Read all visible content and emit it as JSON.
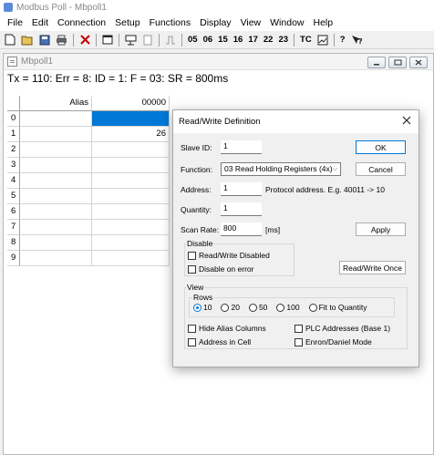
{
  "app": {
    "title": "Modbus Poll - Mbpoll1"
  },
  "menu": [
    "File",
    "Edit",
    "Connection",
    "Setup",
    "Functions",
    "Display",
    "View",
    "Window",
    "Help"
  ],
  "toolbar": {
    "function_codes": [
      "05",
      "06",
      "15",
      "16",
      "17",
      "22",
      "23"
    ],
    "tc_label": "TC",
    "help_label": "?"
  },
  "child": {
    "title": "Mbpoll1",
    "status": "Tx = 110: Err = 8: ID = 1: F = 03: SR = 800ms",
    "grid": {
      "alias_header": "Alias",
      "value_header": "00000",
      "rows": [
        {
          "index": "0",
          "alias": "",
          "value": ""
        },
        {
          "index": "1",
          "alias": "",
          "value": "26"
        },
        {
          "index": "2",
          "alias": "",
          "value": ""
        },
        {
          "index": "3",
          "alias": "",
          "value": ""
        },
        {
          "index": "4",
          "alias": "",
          "value": ""
        },
        {
          "index": "5",
          "alias": "",
          "value": ""
        },
        {
          "index": "6",
          "alias": "",
          "value": ""
        },
        {
          "index": "7",
          "alias": "",
          "value": ""
        },
        {
          "index": "8",
          "alias": "",
          "value": ""
        },
        {
          "index": "9",
          "alias": "",
          "value": ""
        }
      ]
    }
  },
  "dialog": {
    "title": "Read/Write Definition",
    "slave_id_label": "Slave ID:",
    "slave_id_value": "1",
    "function_label": "Function:",
    "function_value": "03 Read Holding Registers (4x)",
    "address_label": "Address:",
    "address_value": "1",
    "address_hint": "Protocol address. E.g. 40011 -> 10",
    "quantity_label": "Quantity:",
    "quantity_value": "1",
    "scan_rate_label": "Scan Rate:",
    "scan_rate_value": "800",
    "scan_rate_unit": "[ms]",
    "ok_label": "OK",
    "cancel_label": "Cancel",
    "apply_label": "Apply",
    "rw_once_label": "Read/Write Once",
    "disable_group": "Disable",
    "rw_disabled_label": "Read/Write Disabled",
    "disable_on_error_label": "Disable on error",
    "view_group": "View",
    "rows_group": "Rows",
    "rows_options": [
      "10",
      "20",
      "50",
      "100",
      "Fit to Quantity"
    ],
    "rows_selected": "10",
    "hide_alias_label": "Hide Alias Columns",
    "address_in_cell_label": "Address in Cell",
    "plc_addresses_label": "PLC Addresses (Base 1)",
    "enron_label": "Enron/Daniel Mode"
  },
  "colors": {
    "selection": "#0078d7",
    "accent": "#0078d7"
  }
}
